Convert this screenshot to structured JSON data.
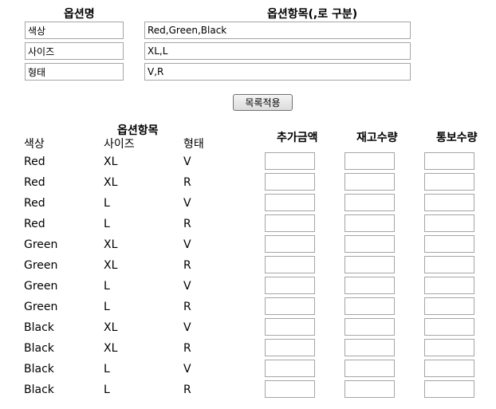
{
  "option_form": {
    "name_header": "옵션명",
    "items_header": "옵션항목(,로 구분)",
    "rows": [
      {
        "name": "색상",
        "items": "Red,Green,Black"
      },
      {
        "name": "사이즈",
        "items": "XL,L"
      },
      {
        "name": "형태",
        "items": "V,R"
      }
    ],
    "apply_label": "목록적용"
  },
  "table": {
    "group_header": "옵션항목",
    "option_headers": [
      "색상",
      "사이즈",
      "형태"
    ],
    "extra_price_header": "추가금액",
    "stock_header": "재고수량",
    "notify_header": "통보수량",
    "rows": [
      {
        "color": "Red",
        "size": "XL",
        "shape": "V",
        "extra": "",
        "stock": "",
        "notify": ""
      },
      {
        "color": "Red",
        "size": "XL",
        "shape": "R",
        "extra": "",
        "stock": "",
        "notify": ""
      },
      {
        "color": "Red",
        "size": "L",
        "shape": "V",
        "extra": "",
        "stock": "",
        "notify": ""
      },
      {
        "color": "Red",
        "size": "L",
        "shape": "R",
        "extra": "",
        "stock": "",
        "notify": ""
      },
      {
        "color": "Green",
        "size": "XL",
        "shape": "V",
        "extra": "",
        "stock": "",
        "notify": ""
      },
      {
        "color": "Green",
        "size": "XL",
        "shape": "R",
        "extra": "",
        "stock": "",
        "notify": ""
      },
      {
        "color": "Green",
        "size": "L",
        "shape": "V",
        "extra": "",
        "stock": "",
        "notify": ""
      },
      {
        "color": "Green",
        "size": "L",
        "shape": "R",
        "extra": "",
        "stock": "",
        "notify": ""
      },
      {
        "color": "Black",
        "size": "XL",
        "shape": "V",
        "extra": "",
        "stock": "",
        "notify": ""
      },
      {
        "color": "Black",
        "size": "XL",
        "shape": "R",
        "extra": "",
        "stock": "",
        "notify": ""
      },
      {
        "color": "Black",
        "size": "L",
        "shape": "V",
        "extra": "",
        "stock": "",
        "notify": ""
      },
      {
        "color": "Black",
        "size": "L",
        "shape": "R",
        "extra": "",
        "stock": "",
        "notify": ""
      }
    ]
  }
}
